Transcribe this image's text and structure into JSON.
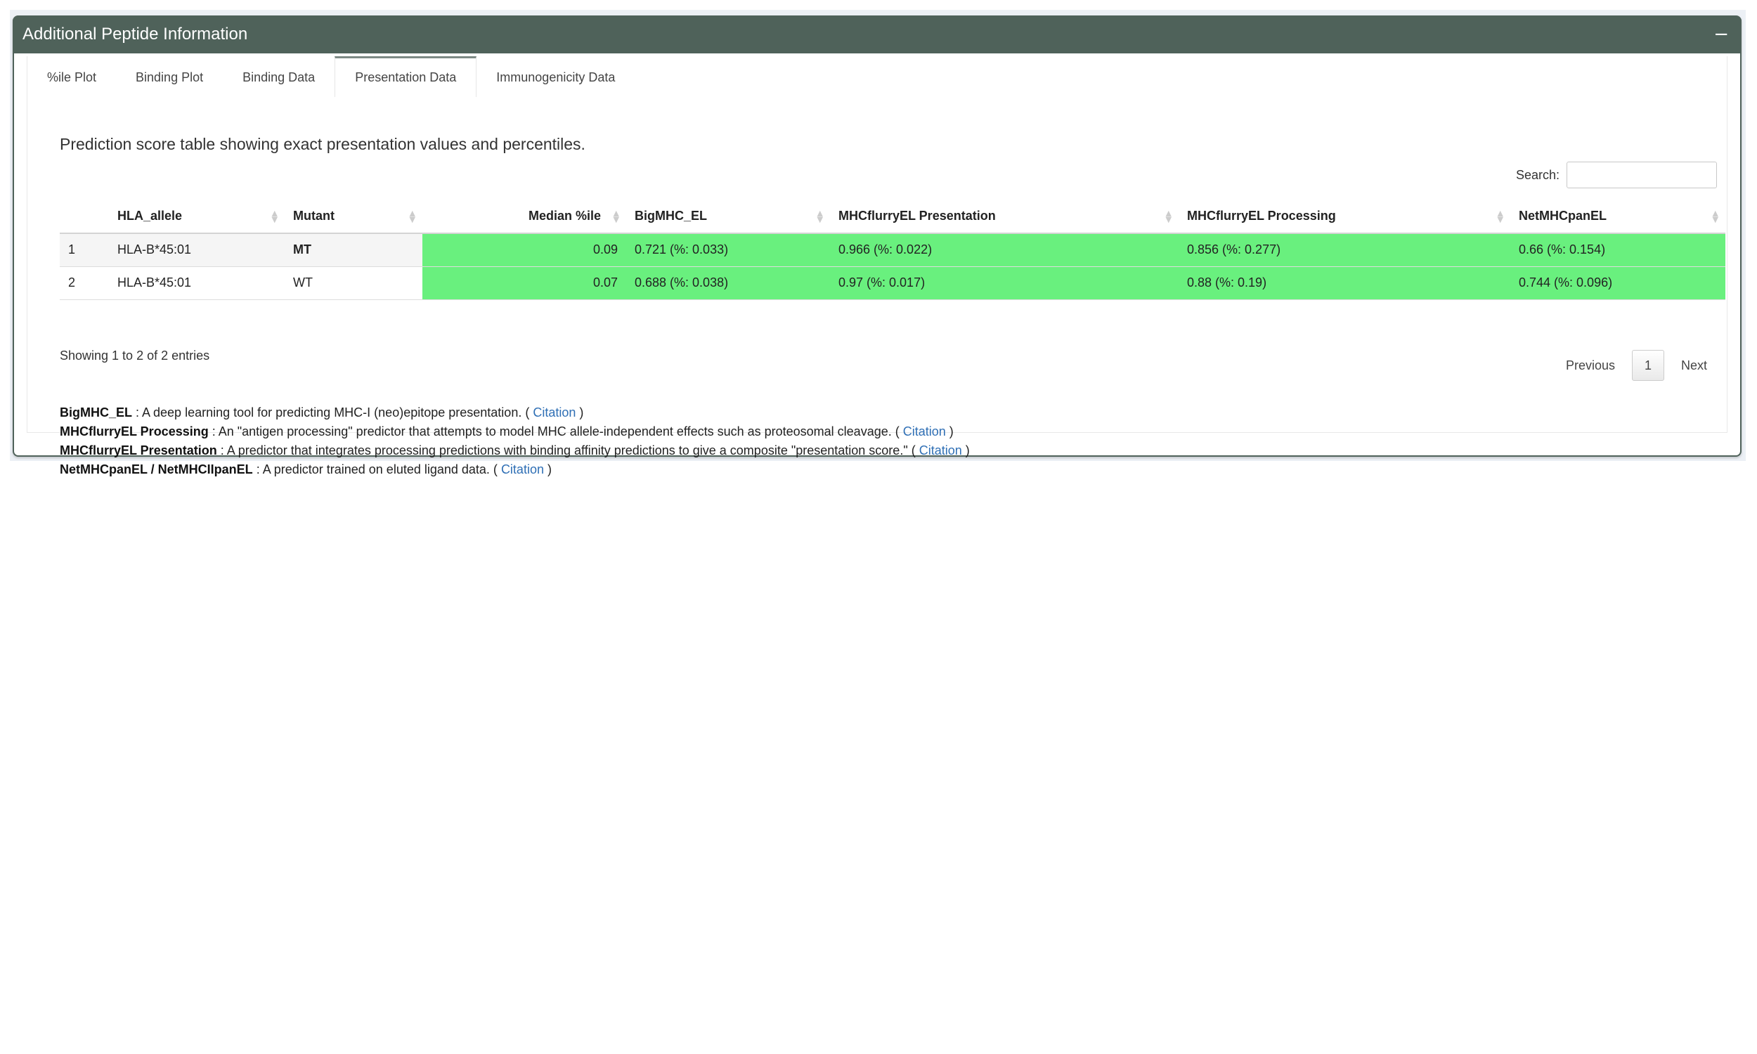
{
  "box": {
    "title": "Additional Peptide Information",
    "collapse_label": "−"
  },
  "tabs": [
    {
      "label": "%ile Plot",
      "active": false
    },
    {
      "label": "Binding Plot",
      "active": false
    },
    {
      "label": "Binding Data",
      "active": false
    },
    {
      "label": "Presentation Data",
      "active": true
    },
    {
      "label": "Immunogenicity Data",
      "active": false
    }
  ],
  "description": "Prediction score table showing exact presentation values and percentiles.",
  "search": {
    "label": "Search:",
    "value": ""
  },
  "table": {
    "columns": [
      "",
      "HLA_allele",
      "Mutant",
      "Median %ile",
      "BigMHC_EL",
      "MHCflurryEL Presentation",
      "MHCflurryEL Processing",
      "NetMHCpanEL"
    ],
    "rows": [
      [
        "1",
        "HLA-B*45:01",
        "MT",
        "0.09",
        "0.721 (%: 0.033)",
        "0.966 (%: 0.022)",
        "0.856 (%: 0.277)",
        "0.66 (%: 0.154)"
      ],
      [
        "2",
        "HLA-B*45:01",
        "WT",
        "0.07",
        "0.688 (%: 0.038)",
        "0.97 (%: 0.017)",
        "0.88 (%: 0.19)",
        "0.744 (%: 0.096)"
      ]
    ],
    "highlight_color": "#69f07e",
    "mutant_color": "#e53935"
  },
  "info": "Showing 1 to 2 of 2 entries",
  "pager": {
    "previous": "Previous",
    "current": "1",
    "next": "Next"
  },
  "notes": [
    {
      "name": "BigMHC_EL",
      "text": " : A deep learning tool for predicting MHC-I (neo)epitope presentation. (",
      "link": "Citation",
      "end": ")"
    },
    {
      "name": "MHCflurryEL Processing",
      "text": " : An \"antigen processing\" predictor that attempts to model MHC allele-independent effects such as proteosomal cleavage. (",
      "link": "Citation",
      "end": ")"
    },
    {
      "name": "MHCflurryEL Presentation",
      "text": " : A predictor that integrates processing predictions with binding affinity predictions to give a composite \"presentation score.\" (",
      "link": "Citation",
      "end": ")"
    },
    {
      "name": "NetMHCpanEL / NetMHCIIpanEL",
      "text": " : A predictor trained on eluted ligand data. (",
      "link": "Citation",
      "end": ")"
    }
  ],
  "colors": {
    "header_bg": "#4f625a",
    "link": "#2f6fb5"
  }
}
